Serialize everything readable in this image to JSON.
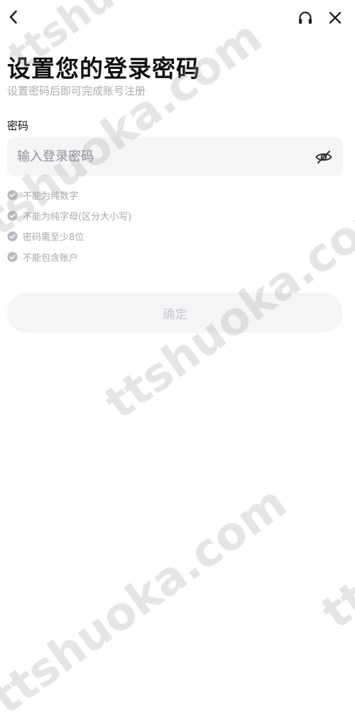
{
  "header": {
    "back_icon": "chevron-left-icon",
    "support_icon": "headset-icon",
    "close_icon": "close-icon"
  },
  "title": "设置您的登录密码",
  "subtitle": "设置密码后即可完成账号注册",
  "password": {
    "label": "密码",
    "placeholder": "输入登录密码",
    "value": "",
    "visibility_icon": "eye-hidden-icon"
  },
  "rules": [
    {
      "text": "不能为纯数字",
      "icon": "check-circle-icon"
    },
    {
      "text": "不能为纯字母(区分大小写)",
      "icon": "check-circle-icon"
    },
    {
      "text": "密码需至少8位",
      "icon": "check-circle-icon"
    },
    {
      "text": "不能包含账户",
      "icon": "check-circle-icon"
    }
  ],
  "confirm_button": "确定",
  "watermark": "ttshuoka.com",
  "colors": {
    "rule_check": "#b9bbc0",
    "field_bg": "#f4f5f7",
    "button_text_disabled": "#c5c7cc"
  }
}
